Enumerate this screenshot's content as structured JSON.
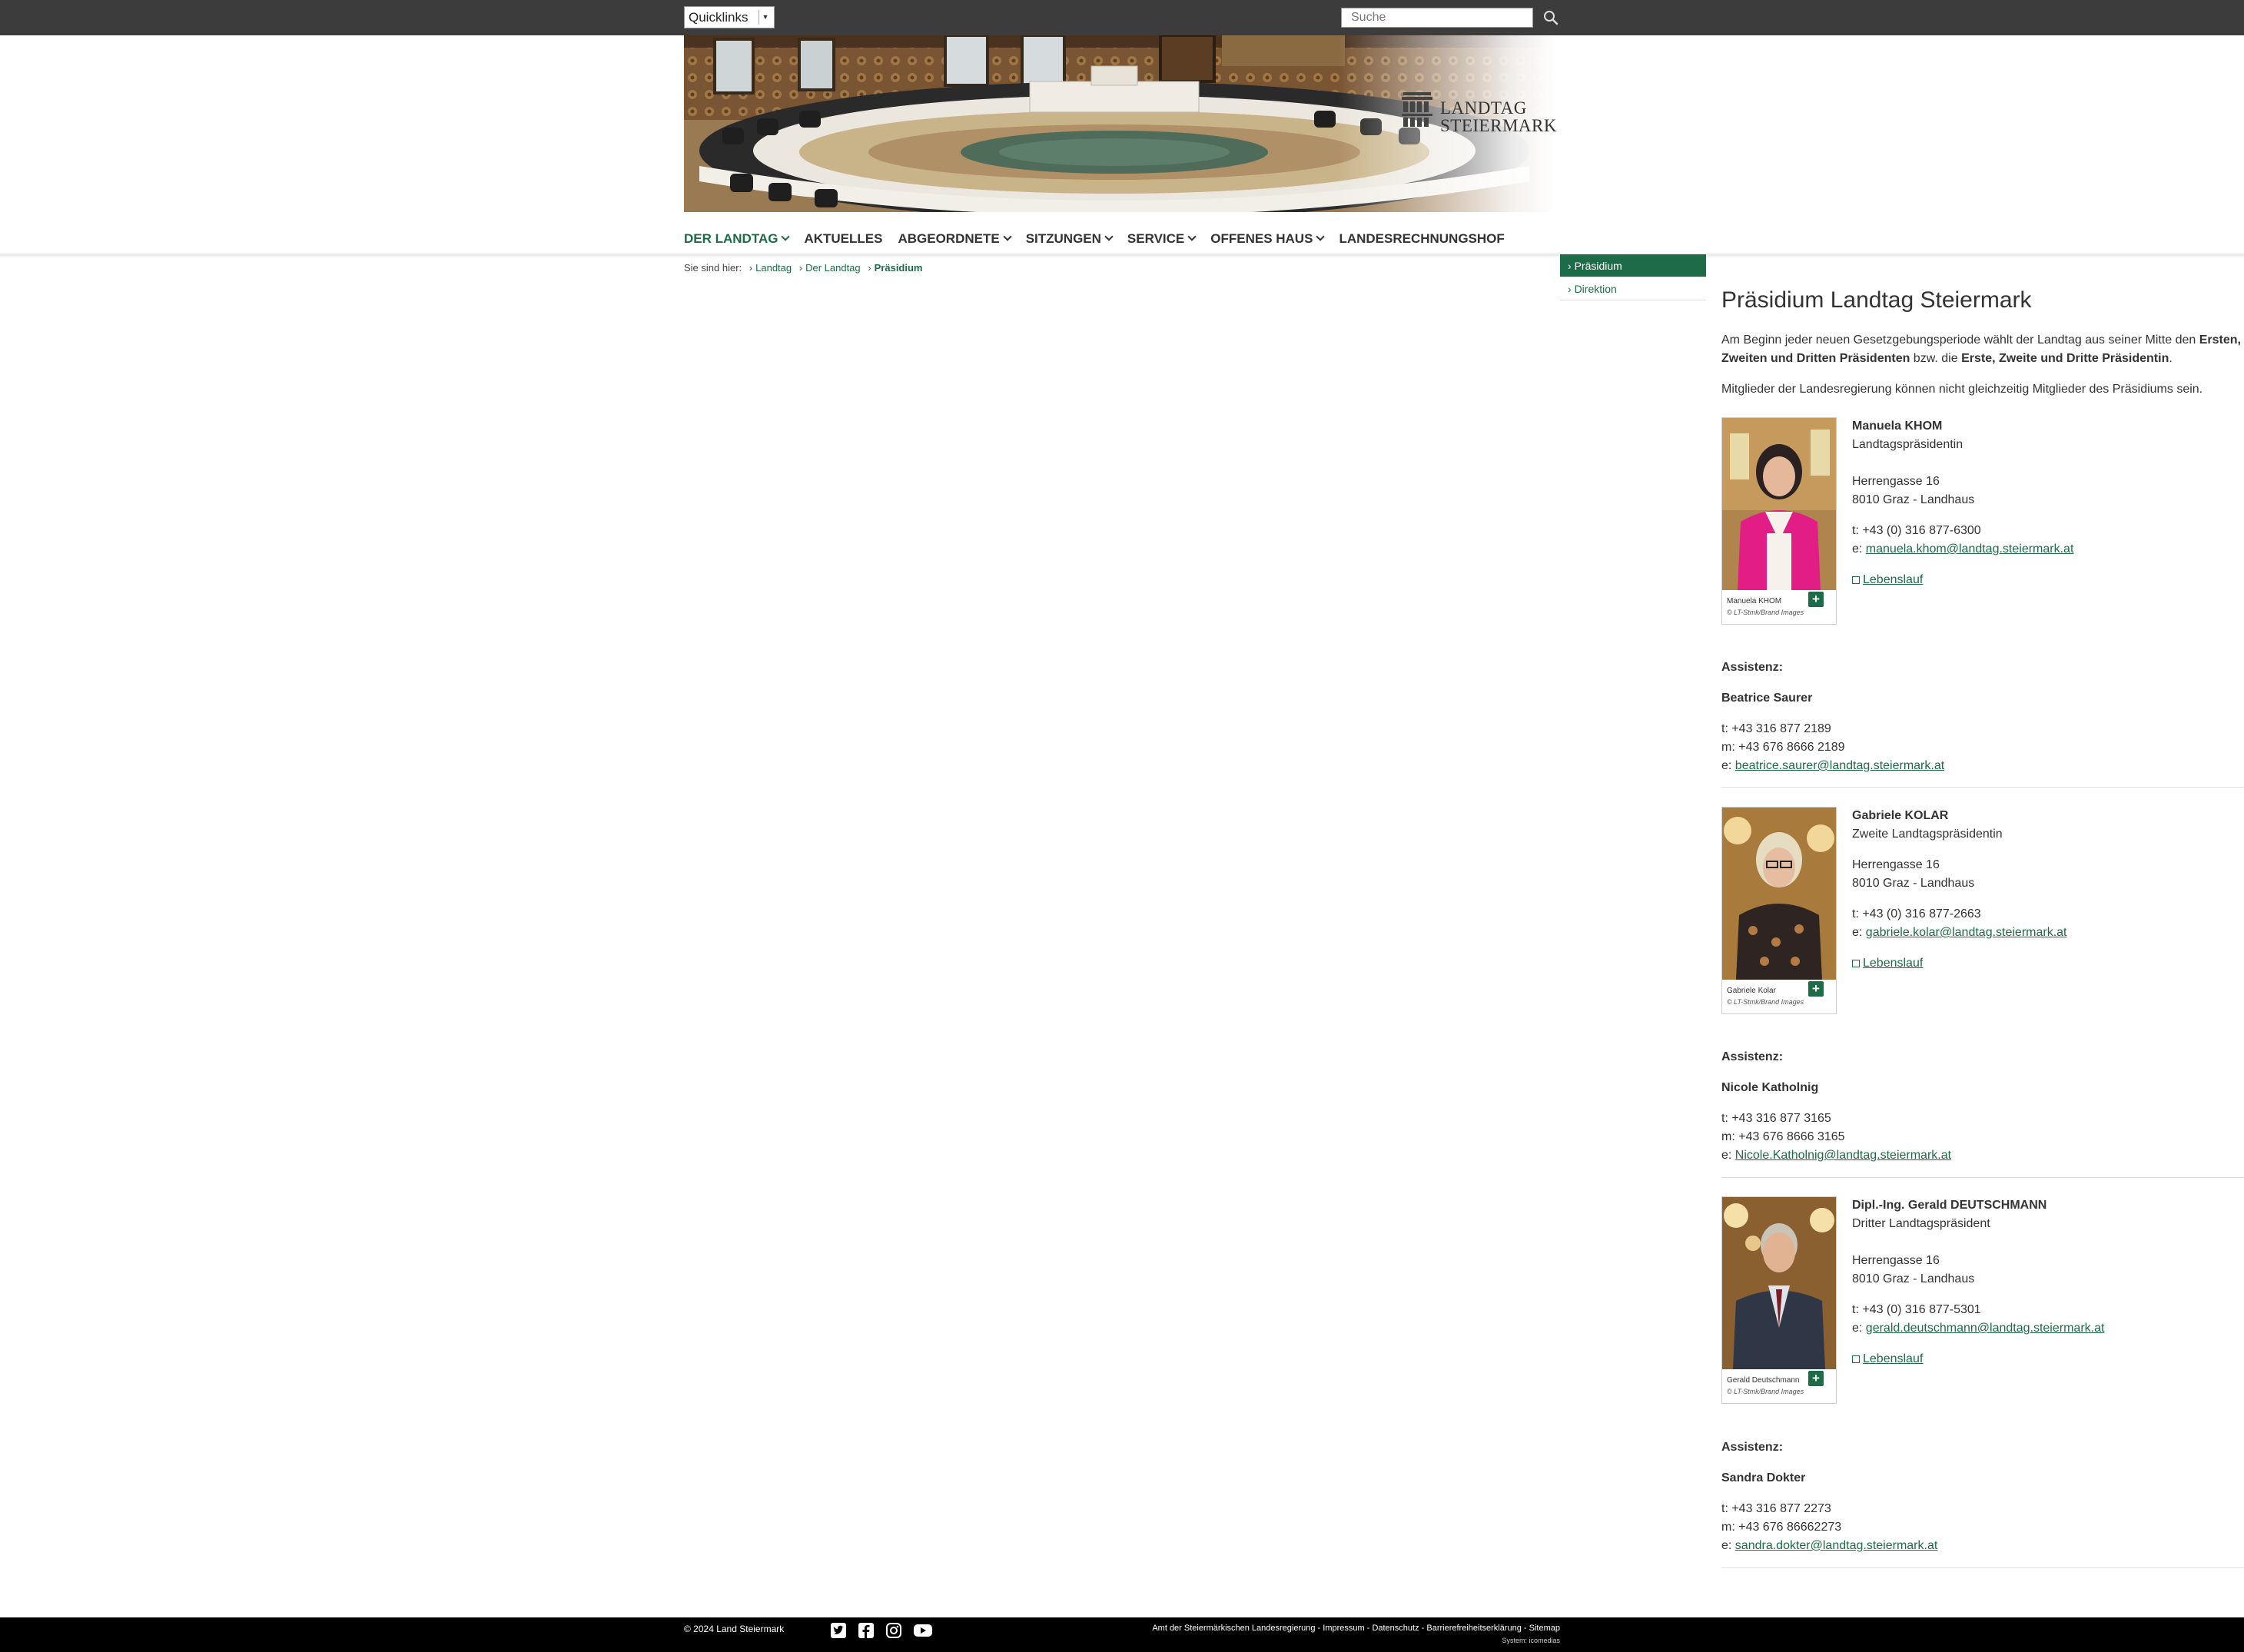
{
  "topbar": {
    "quicklinks_label": "Quicklinks",
    "search_placeholder": "Suche"
  },
  "header": {
    "logo_line1": "LANDTAG",
    "logo_line2": "STEIERMARK"
  },
  "nav": {
    "items": [
      {
        "label": "DER LANDTAG"
      },
      {
        "label": "AKTUELLES"
      },
      {
        "label": "ABGEORDNETE"
      },
      {
        "label": "SITZUNGEN"
      },
      {
        "label": "SERVICE"
      },
      {
        "label": "OFFENES HAUS"
      },
      {
        "label": "LANDESRECHNUNGSHOF"
      }
    ]
  },
  "breadcrumb": {
    "prefix": "Sie sind hier:",
    "items": [
      "Landtag",
      "Der Landtag",
      "Präsidium"
    ]
  },
  "subnav": {
    "items": [
      "Präsidium",
      "Direktion"
    ]
  },
  "content": {
    "title": "Präsidium Landtag Steiermark",
    "intro": {
      "line1_a": "Am Beginn jeder neuen Gesetzgebungsperiode wählt der Landtag aus seiner Mitte den ",
      "line1_b": "Ersten,",
      "line2_a": "Zweiten und Dritten Präsidenten",
      "line2_b": " bzw. die ",
      "line2_c": "Erste, Zweite und Dritte Präsidentin",
      "line2_d": "."
    },
    "note": "Mitglieder der Landesregierung können nicht gleichzeitig Mitglieder des Präsidiums sein.",
    "persons": [
      {
        "name": "Manuela KHOM",
        "role": "Landtagspräsidentin",
        "street": "Herrengasse 16",
        "city": "8010 Graz - Landhaus",
        "phone": "t: +43 (0) 316 877-6300",
        "email_prefix": "e: ",
        "email": "manuela.khom@landtag.steiermark.at",
        "cv": "Lebenslauf",
        "photo_caption": "Manuela KHOM",
        "photo_copy": "© LT-Stmk/Brand Images",
        "assist_label": "Assistenz:",
        "assist_name": "Beatrice Saurer",
        "assist_t": "t: +43 316 877 2189",
        "assist_m": "m: +43 676 8666 2189",
        "assist_e_prefix": "e: ",
        "assist_e": "beatrice.saurer@landtag.steiermark.at"
      },
      {
        "name": "Gabriele KOLAR",
        "role": "Zweite Landtagspräsidentin",
        "street": "Herrengasse 16",
        "city": "8010 Graz - Landhaus",
        "phone": "t: +43 (0) 316 877-2663",
        "email_prefix": "e: ",
        "email": "gabriele.kolar@landtag.steiermark.at",
        "cv": "Lebenslauf",
        "photo_caption": "Gabriele Kolar",
        "photo_copy": "© LT-Stmk/Brand Images",
        "assist_label": "Assistenz:",
        "assist_name": "Nicole Katholnig",
        "assist_t": "t: +43 316 877 3165",
        "assist_m": "m: +43 676 8666 3165",
        "assist_e_prefix": "e: ",
        "assist_e": "Nicole.Katholnig@landtag.steiermark.at"
      },
      {
        "name": "Dipl.-Ing. Gerald DEUTSCHMANN",
        "role": "Dritter Landtagspräsident",
        "street": "Herrengasse 16",
        "city": "8010 Graz - Landhaus",
        "phone": "t: +43 (0) 316 877-5301",
        "email_prefix": "e: ",
        "email": "gerald.deutschmann@landtag.steiermark.at",
        "cv": "Lebenslauf",
        "photo_caption": "Gerald Deutschmann",
        "photo_copy": "© LT-Stmk/Brand Images",
        "assist_label": "Assistenz:",
        "assist_name": "Sandra Dokter",
        "assist_t": "t: +43 316 877 2273",
        "assist_m": "m: +43 676 86662273",
        "assist_e_prefix": "e: ",
        "assist_e": "sandra.dokter@landtag.steiermark.at"
      }
    ]
  },
  "footer": {
    "copyright": "© 2024 Land Steiermark",
    "links": "Amt der Steiermärkischen Landesregierung - Impressum - Datenschutz - Barrierefreiheitserklärung - Sitemap",
    "system": "System: icomedias",
    "social": [
      "twitter-icon",
      "facebook-icon",
      "instagram-icon",
      "youtube-icon"
    ]
  },
  "colors": {
    "accent": "#1e6b47",
    "topbar": "#3c3c3c",
    "footer": "#000000"
  }
}
